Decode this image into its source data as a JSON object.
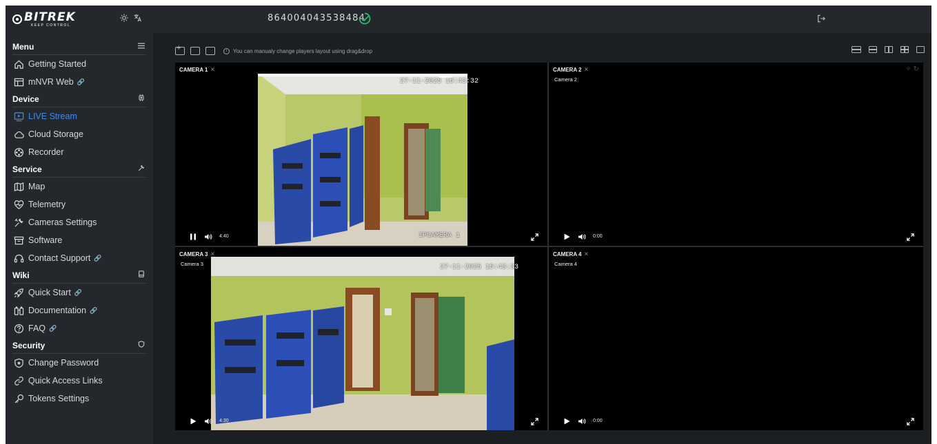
{
  "brand": {
    "name": "BITREK",
    "tagline": "KEEP CONTROL",
    "theme_icon": "sun-icon",
    "language_icon": "translate-icon"
  },
  "header": {
    "device_id": "864004043538484",
    "status_icon": "online-check-icon",
    "logout_icon": "logout-icon"
  },
  "nav": {
    "menu": {
      "title": "Menu",
      "icon": "hamburger-icon",
      "items": [
        {
          "label": "Getting Started",
          "icon": "home-icon"
        },
        {
          "label": "mNVR Web",
          "icon": "layout-icon",
          "external": true
        }
      ]
    },
    "device": {
      "title": "Device",
      "icon": "chip-icon",
      "items": [
        {
          "label": "LIVE Stream",
          "icon": "live-stream-icon",
          "active": true
        },
        {
          "label": "Cloud Storage",
          "icon": "cloud-icon"
        },
        {
          "label": "Recorder",
          "icon": "reel-icon"
        }
      ]
    },
    "service": {
      "title": "Service",
      "icon": "wrench-icon",
      "items": [
        {
          "label": "Map",
          "icon": "map-icon"
        },
        {
          "label": "Telemetry",
          "icon": "heart-pulse-icon"
        },
        {
          "label": "Cameras Settings",
          "icon": "tools-icon"
        },
        {
          "label": "Software",
          "icon": "archive-icon"
        },
        {
          "label": "Contact Support",
          "icon": "headset-icon",
          "external": true
        }
      ]
    },
    "wiki": {
      "title": "Wiki",
      "icon": "tablet-icon",
      "items": [
        {
          "label": "Quick Start",
          "icon": "rocket-icon",
          "external": true
        },
        {
          "label": "Documentation",
          "icon": "binoculars-icon",
          "external": true
        },
        {
          "label": "FAQ",
          "icon": "question-icon",
          "external": true
        }
      ]
    },
    "security": {
      "title": "Security",
      "icon": "shield-icon",
      "items": [
        {
          "label": "Change Password",
          "icon": "shield-star-icon"
        },
        {
          "label": "Quick Access Links",
          "icon": "link-icon"
        },
        {
          "label": "Tokens Settings",
          "icon": "key-icon"
        }
      ]
    }
  },
  "toolbar": {
    "hint": "You can manualy change players layout using drag&drop",
    "layout_buttons": [
      "layout-wide-icon",
      "layout-rows-icon",
      "layout-columns-icon",
      "layout-grid-icon",
      "layout-single-icon"
    ]
  },
  "players": [
    {
      "title": "CAMERA 1",
      "subtitle": "",
      "time": "4:40",
      "playing": true,
      "osd_time": "27-11-2025 15:43:32",
      "osd_name": "IPCAMERA 1"
    },
    {
      "title": "CAMERA 2",
      "subtitle": "Camera 2",
      "time": "0:00",
      "playing": false
    },
    {
      "title": "CAMERA 3",
      "subtitle": "Camera 3",
      "time": "4:30",
      "playing": false,
      "osd_time": "27-11-2025 15:43:33"
    },
    {
      "title": "CAMERA 4",
      "subtitle": "Camera 4",
      "time": "0:00",
      "playing": false
    }
  ],
  "colors": {
    "accent": "#3c8cf0",
    "online": "#2fbf71",
    "panel": "#24272b",
    "background": "#1c1f22"
  }
}
